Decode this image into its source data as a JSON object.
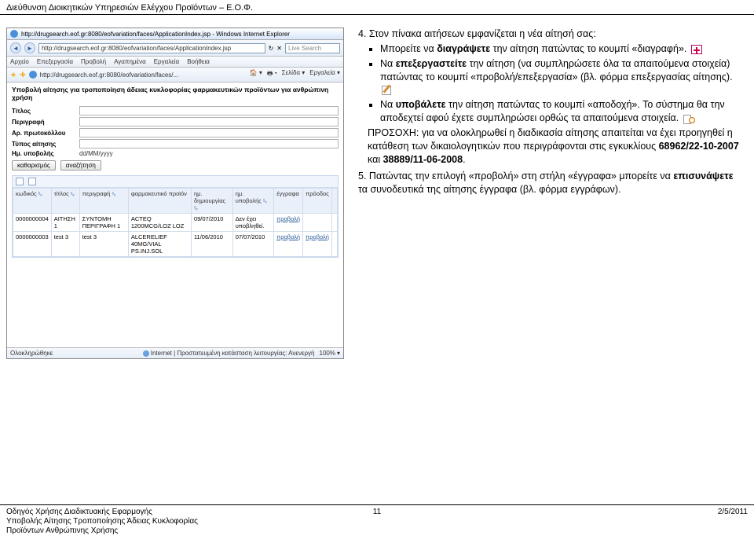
{
  "header": {
    "title": "Διεύθυνση Διοικητικών Υπηρεσιών Ελέγχου Προϊόντων – Ε.Ο.Φ."
  },
  "browser": {
    "window_title": "http://drugsearch.eof.gr:8080/eofvariation/faces/ApplicationIndex.jsp - Windows Internet Explorer",
    "url": "http://drugsearch.eof.gr:8080/eofvariation/faces/ApplicationIndex.jsp",
    "search_placeholder": "Live Search",
    "menus": [
      "Αρχείο",
      "Επεξεργασία",
      "Προβολή",
      "Αγαπημένα",
      "Εργαλεία",
      "Βοήθεια"
    ],
    "tab_label": "http://drugsearch.eof.gr:8080/eofvariation/faces/...",
    "tools": {
      "home": "",
      "page": "Σελίδα ▾",
      "tools": "Εργαλεία ▾"
    },
    "app_title": "Υποβολή αίτησης για τροποποίηση άδειας κυκλοφορίας φαρμακευτικών προϊόντων για ανθρώπινη χρήση",
    "form": {
      "labels": {
        "titlos": "Τίτλος",
        "perigrafi": "Περιγραφή",
        "ar_protokollou": "Αρ. πρωτοκόλλου",
        "typos": "Τύπος αίτησης",
        "hm_ypovolis": "Ημ. υποβολής",
        "hm_value": "dd/MM/yyyy"
      },
      "buttons": {
        "clear": "καθαρισμός",
        "search": "αναζήτηση"
      }
    },
    "grid": {
      "headers": {
        "kodikos": "κωδικός",
        "titlos": "τίτλος",
        "perigrafi": "περιγραφή",
        "farmako": "φαρμακευτικό προϊόν",
        "hm_dim": "ημ. δημιουργίας",
        "hm_yp": "ημ. υποβολής",
        "eggrafa": "έγγραφα",
        "proodos": "πρόοδος",
        "sort": "ˢₓ"
      },
      "rows": [
        {
          "kodikos": "0000000004",
          "titlos": "ΑΙΤΗΣΗ 1",
          "perigrafi": "ΣΥΝΤΟΜΗ ΠΕΡΙΓΡΑΦΗ 1",
          "farmako": "ACTEQ 1200MCG/LOZ LOZ",
          "hm_dim": "09/07/2010",
          "hm_yp": "Δεν έχει υποβληθεί.",
          "eggrafa": "προβολή",
          "proodos": ""
        },
        {
          "kodikos": "0000000003",
          "titlos": "test 3",
          "perigrafi": "test 3",
          "farmako": "ALCERELIEF 40MG/VIAL PS.INJ.SOL",
          "hm_dim": "11/06/2010",
          "hm_yp": "07/07/2010",
          "eggrafa": "προβολή",
          "proodos": "προβολή"
        }
      ]
    },
    "status": {
      "done": "Ολοκληρώθηκε",
      "zone": "Internet | Προστατευμένη κατάσταση λειτουργίας: Ανενεργή",
      "zoom": "100%"
    }
  },
  "instructions": {
    "start_num": "4.",
    "step4_intro": "Στον πίνακα αιτήσεων εμφανίζεται η νέα αίτησή σας:",
    "b1a": "Μπορείτε να ",
    "b1b": "διαγράψετε",
    "b1c": " την αίτηση πατώντας το κουμπί «διαγραφή».",
    "b2a": "Να ",
    "b2b": "επεξεργαστείτε",
    "b2c": " την αίτηση (να συμπληρώσετε όλα τα απαιτούμενα στοιχεία) πατώντας το κουμπί «προβολή/επεξεργασία» (βλ. φόρμα επεξεργασίας αίτησης).",
    "b3a": "Να ",
    "b3b": "υποβάλετε",
    "b3c": " την αίτηση πατώντας το κουμπί «αποδοχή». Το σύστημα θα την αποδεχτεί αφού έχετε συμπληρώσει ορθώς τα απαιτούμενα στοιχεία.",
    "b4a": "ΠΡΟΣΟΧΗ: για να ολοκληρωθεί η διαδικασία αίτησης απαιτείται να έχει προηγηθεί η κατάθεση των δικαιολογητικών που περιγράφονται στις εγκυκλίους ",
    "b4b": "68962/22-10-2007",
    "b4c": " και ",
    "b4d": "38889/11-06-2008",
    "b4e": ".",
    "step5_num": "5.",
    "step5a": "Πατώντας την επιλογή «προβολή» στη στήλη «έγγραφα» μπορείτε να ",
    "step5b": "επισυνάψετε",
    "step5c": " τα συνοδευτικά της αίτησης έγγραφα (βλ. φόρμα εγγράφων)."
  },
  "footer": {
    "left1": "Οδηγός Χρήσης Διαδικτυακής Εφαρμογής",
    "left2": "Υποβολής Αίτησης Τροποποίησης Άδειας Κυκλοφορίας",
    "left3": "Προϊόντων Ανθρώπινης Χρήσης",
    "page": "11",
    "date": "2/5/2011"
  }
}
